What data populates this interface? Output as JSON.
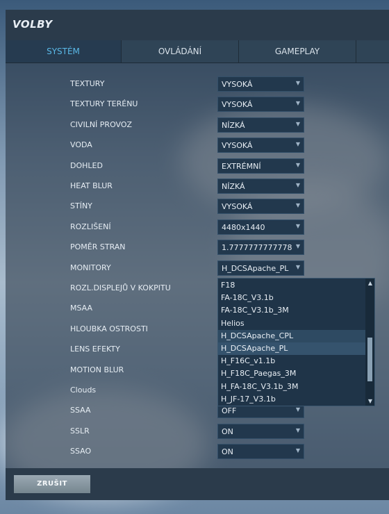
{
  "window": {
    "title": "VOLBY"
  },
  "tabs": [
    {
      "label": "SYSTÉM",
      "active": true
    },
    {
      "label": "OVLÁDÁNÍ",
      "active": false
    },
    {
      "label": "GAMEPLAY",
      "active": false
    }
  ],
  "settings": [
    {
      "label": "TEXTURY",
      "value": "VYSOKÁ"
    },
    {
      "label": "TEXTURY TERÉNU",
      "value": "VYSOKÁ"
    },
    {
      "label": "CIVILNÍ PROVOZ",
      "value": "NÍZKÁ"
    },
    {
      "label": "VODA",
      "value": "VYSOKÁ"
    },
    {
      "label": "DOHLED",
      "value": "EXTRÉMNÍ"
    },
    {
      "label": "HEAT BLUR",
      "value": "NÍZKÁ"
    },
    {
      "label": "STÍNY",
      "value": "VYSOKÁ"
    },
    {
      "label": "ROZLIŠENÍ",
      "value": "4480x1440"
    },
    {
      "label": "POMĚR STRAN",
      "value": "1.7777777777778"
    },
    {
      "label": "MONITORY",
      "value": "H_DCSApache_PL"
    },
    {
      "label": "ROZL.DISPLEJŮ V KOKPITU",
      "value": ""
    },
    {
      "label": "MSAA",
      "value": ""
    },
    {
      "label": "HLOUBKA OSTROSTI",
      "value": ""
    },
    {
      "label": "LENS EFEKTY",
      "value": ""
    },
    {
      "label": "MOTION BLUR",
      "value": ""
    },
    {
      "label": "Clouds",
      "value": ""
    },
    {
      "label": "SSAA",
      "value": "OFF"
    },
    {
      "label": "SSLR",
      "value": "ON"
    },
    {
      "label": "SSAO",
      "value": "ON"
    }
  ],
  "monitor_dropdown": {
    "options": [
      "F18",
      "FA-18C_V3.1b",
      "FA-18C_V3.1b_3M",
      "Helios",
      "H_DCSApache_CPL",
      "H_DCSApache_PL",
      "H_F16C_v1.1b",
      "H_F18C_Paegas_3M",
      "H_FA-18C_V3.1b_3M",
      "H_JF-17_V3.1b"
    ],
    "hovered": "H_DCSApache_CPL",
    "selected": "H_DCSApache_PL"
  },
  "footer": {
    "cancel_label": "ZRUŠIT"
  },
  "colors": {
    "accent": "#5ab8e6",
    "panel": "#2b3b4b",
    "field": "#22384d"
  }
}
